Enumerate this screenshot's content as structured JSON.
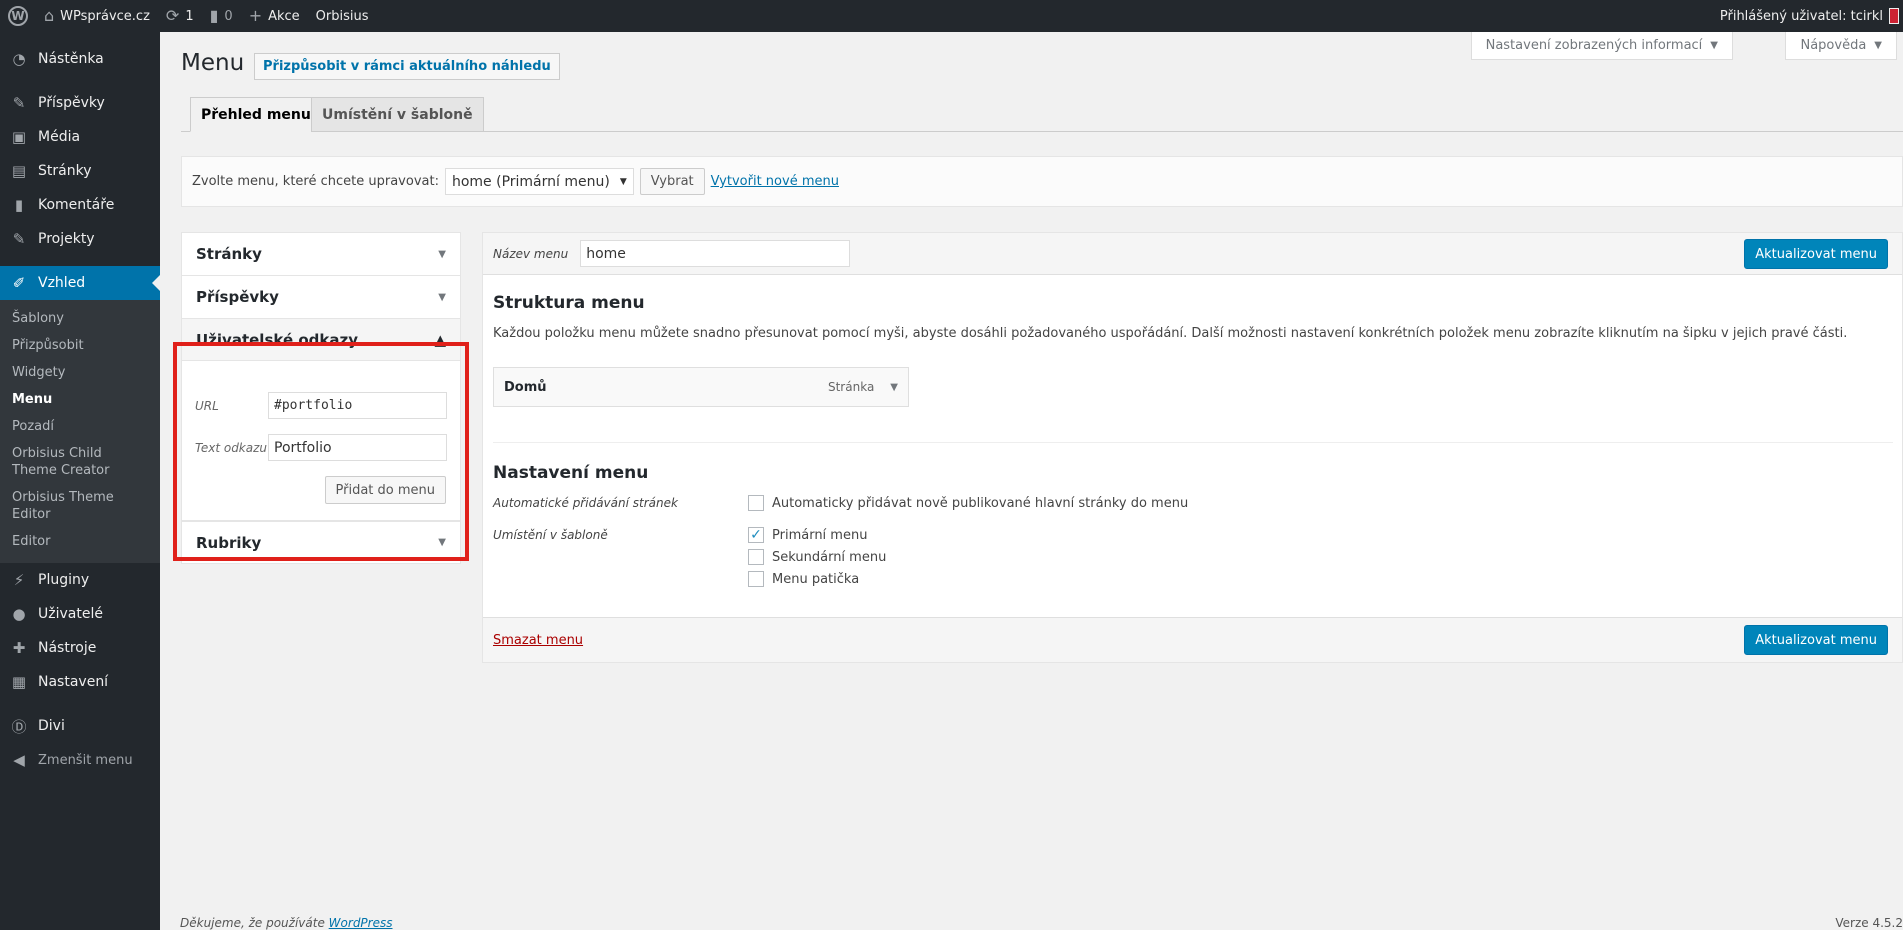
{
  "adminbar": {
    "site_name": "WPsprávce.cz",
    "updates_count": "1",
    "comments_count": "0",
    "new_label": "Akce",
    "theme_label": "Orbisius",
    "user_greeting": "Přihlášený uživatel: tcirkl"
  },
  "sidebar": {
    "items": [
      {
        "label": "Nástěnka",
        "icon": "dashboard-icon"
      },
      {
        "label": "Příspěvky",
        "icon": "pin-icon"
      },
      {
        "label": "Média",
        "icon": "media-icon"
      },
      {
        "label": "Stránky",
        "icon": "pages-icon"
      },
      {
        "label": "Komentáře",
        "icon": "comments-icon"
      },
      {
        "label": "Projekty",
        "icon": "pin-icon"
      },
      {
        "label": "Vzhled",
        "icon": "brush-icon"
      },
      {
        "label": "Pluginy",
        "icon": "plugin-icon"
      },
      {
        "label": "Uživatelé",
        "icon": "user-icon"
      },
      {
        "label": "Nástroje",
        "icon": "wrench-icon"
      },
      {
        "label": "Nastavení",
        "icon": "settings-icon"
      },
      {
        "label": "Divi",
        "icon": "divi-icon"
      },
      {
        "label": "Zmenšit menu",
        "icon": "collapse-icon"
      }
    ],
    "appearance_submenu": [
      "Šablony",
      "Přizpůsobit",
      "Widgety",
      "Menu",
      "Pozadí",
      "Orbisius Child Theme Creator",
      "Orbisius Theme Editor",
      "Editor"
    ]
  },
  "screen_meta": {
    "options_label": "Nastavení zobrazených informací",
    "help_label": "Nápověda"
  },
  "page": {
    "title": "Menu",
    "customize_button": "Přizpůsobit v rámci aktuálního náhledu",
    "tabs": [
      "Přehled menu",
      "Umístění v šabloně"
    ]
  },
  "manage": {
    "prompt": "Zvolte menu, které chcete upravovat:",
    "selected_menu": "home (Primární menu)",
    "select_button": "Vybrat",
    "create_link": "Vytvořit nové menu"
  },
  "accordion": {
    "sections": [
      "Stránky",
      "Příspěvky",
      "Uživatelské odkazy",
      "Rubriky"
    ],
    "custom_links": {
      "url_label": "URL",
      "url_value": "#portfolio",
      "text_label": "Text odkazu",
      "text_value": "Portfolio",
      "add_button": "Přidat do menu"
    },
    "highlight_color": "#e0201a"
  },
  "menu_edit": {
    "name_label": "Název menu",
    "name_value": "home",
    "save_button": "Aktualizovat menu",
    "structure_title": "Struktura menu",
    "structure_desc": "Každou položku menu můžete snadno přesunovat pomocí myši, abyste dosáhli požadovaného uspořádání. Další možnosti nastavení konkrétních položek menu zobrazíte kliknutím na šipku v jejich pravé části.",
    "items": [
      {
        "title": "Domů",
        "type": "Stránka"
      }
    ],
    "settings_title": "Nastavení menu",
    "auto_add_label": "Automatické přidávání stránek",
    "auto_add_option": "Automaticky přidávat nově publikované hlavní stránky do menu",
    "locations_label": "Umístění v šabloně",
    "locations": [
      {
        "label": "Primární menu",
        "checked": true
      },
      {
        "label": "Sekundární menu",
        "checked": false
      },
      {
        "label": "Menu patička",
        "checked": false
      }
    ],
    "delete_link": "Smazat menu"
  },
  "footer": {
    "thanks": "Děkujeme, že používáte",
    "wp_link": "WordPress",
    "version": "Verze 4.5.2"
  },
  "colors": {
    "admin_dark": "#23282d",
    "accent": "#0073aa",
    "primary_button": "#0085ba"
  }
}
